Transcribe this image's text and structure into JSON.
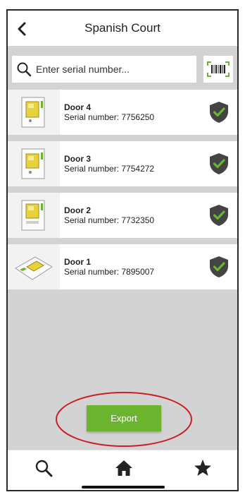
{
  "header": {
    "title": "Spanish Court"
  },
  "search": {
    "placeholder": "Enter serial number..."
  },
  "doors": [
    {
      "name": "Door 4",
      "serial": "Serial number: 7756250"
    },
    {
      "name": "Door 3",
      "serial": "Serial number: 7754272"
    },
    {
      "name": "Door 2",
      "serial": "Serial number: 7732350"
    },
    {
      "name": "Door 1",
      "serial": "Serial number: 7895007"
    }
  ],
  "actions": {
    "export_label": "Export"
  },
  "tabbar": {
    "icons": [
      "search-icon",
      "home-icon",
      "star-icon"
    ]
  },
  "colors": {
    "accent": "#6ab42e",
    "shield": "#444444",
    "check": "#6ab42e",
    "highlight_ring": "#c8202a",
    "list_background": "#d3d3d3"
  }
}
